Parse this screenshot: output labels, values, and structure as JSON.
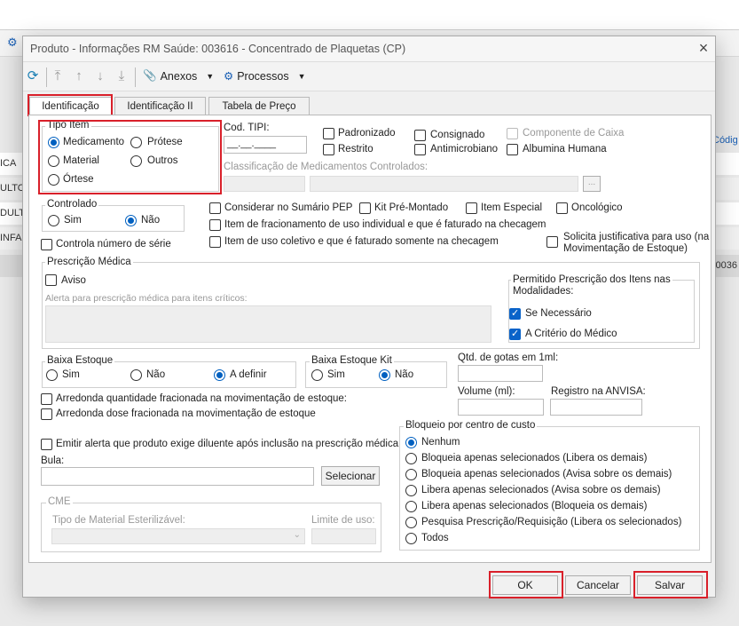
{
  "background": {
    "rows": [
      {
        "left": "ICA",
        "right": ""
      },
      {
        "left": "ULTO",
        "right": ""
      },
      {
        "left": "DULT",
        "right": ""
      },
      {
        "left": "INFAN",
        "right": ""
      },
      {
        "left": "",
        "right": "0036"
      }
    ],
    "column_header_right": "Códig"
  },
  "dialog": {
    "title": "Produto - Informações RM Saúde: 003616 -  Concentrado de Plaquetas (CP)",
    "close": "×"
  },
  "toolbar": {
    "anexos": "Anexos",
    "processos": "Processos"
  },
  "tabs": [
    "Identificação",
    "Identificação II",
    "Tabela de Preço"
  ],
  "tipo_item": {
    "label": "Tipo Item",
    "options": [
      "Medicamento",
      "Prótese",
      "Material",
      "Outros",
      "Órtese"
    ],
    "selected": "Medicamento"
  },
  "cod_tipi": {
    "label": "Cod. TIPI:",
    "value": "__.__.____"
  },
  "flags": {
    "padronizado": "Padronizado",
    "restrito": "Restrito",
    "consignado": "Consignado",
    "antimicrobiano": "Antimicrobiano",
    "componente_caixa": "Componente de Caixa",
    "albumina": "Albumina Humana"
  },
  "classificacao_label": "Classificação de Medicamentos Controlados:",
  "ellipsis": "...",
  "controlado": {
    "label": "Controlado",
    "sim": "Sim",
    "nao": "Não",
    "selected": "Não"
  },
  "controla_serie": "Controla número de série",
  "checks_mid": {
    "sumario": "Considerar no Sumário PEP",
    "kit": "Kit Pré-Montado",
    "especial": "Item Especial",
    "oncologico": "Oncológico",
    "fracionamento": "Item de fracionamento de uso individual e que é faturado na checagem",
    "coletivo": "Item de uso coletivo e que é faturado somente na checagem",
    "justificativa_1": "Solicita justificativa para uso (na",
    "justificativa_2": "Movimentação de Estoque)"
  },
  "prescricao": {
    "label": "Prescrição Médica",
    "aviso": "Aviso",
    "alerta_label": "Alerta para prescrição médica para itens críticos:",
    "permitido_1": "Permitido Prescrição dos Itens nas",
    "permitido_2": "Modalidades:",
    "se_necessario": "Se Necessário",
    "criterio": "A Critério do Médico"
  },
  "baixa_estoque": {
    "label": "Baixa Estoque",
    "sim": "Sim",
    "nao": "Não",
    "definir": "A definir",
    "selected": "A definir"
  },
  "baixa_kit": {
    "label": "Baixa Estoque Kit",
    "sim": "Sim",
    "nao": "Não",
    "selected": "Não"
  },
  "qtd_gotas": "Qtd. de gotas em 1ml:",
  "volume": "Volume (ml):",
  "registro": "Registro na ANVISA:",
  "arredonda_qtd": "Arredonda quantidade fracionada na movimentação de estoque:",
  "arredonda_dose": "Arredonda dose fracionada na movimentação de estoque",
  "emitir_alerta": "Emitir alerta que produto exige diluente após inclusão na prescrição médica",
  "bula": {
    "label": "Bula:",
    "button": "Selecionar"
  },
  "cme": {
    "label": "CME",
    "tipo": "Tipo de Material Esterilizável:",
    "limite": "Limite de uso:"
  },
  "bloqueio": {
    "label": "Bloqueio por centro de custo",
    "options": [
      "Nenhum",
      "Bloqueia apenas selecionados (Libera os demais)",
      "Bloqueia apenas selecionados (Avisa sobre os demais)",
      "Libera apenas selecionados (Avisa sobre os demais)",
      "Libera apenas selecionados (Bloqueia os demais)",
      "Pesquisa Prescrição/Requisição (Libera os selecionados)",
      "Todos"
    ],
    "selected": "Nenhum"
  },
  "footer": {
    "ok": "OK",
    "cancelar": "Cancelar",
    "salvar": "Salvar"
  },
  "colors": {
    "accent": "#0060c0",
    "highlight": "#d9202a"
  }
}
